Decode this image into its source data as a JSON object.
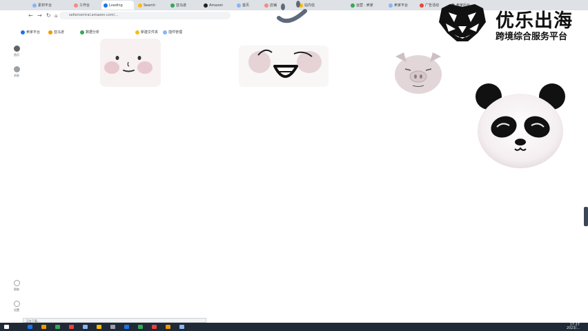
{
  "tabs": [
    {
      "label": "素材平台",
      "color": "#8ab4f8"
    },
    {
      "label": "工作台",
      "color": "#f28b82"
    },
    {
      "label": "Loading",
      "color": "#1a73e8",
      "active": true
    },
    {
      "label": "Search",
      "color": "#fbbc04"
    },
    {
      "label": "亚马逊",
      "color": "#34a853"
    },
    {
      "label": "Amazon",
      "color": "#202124"
    },
    {
      "label": "首页",
      "color": "#8ab4f8"
    },
    {
      "label": "店铺",
      "color": "#f28b82"
    },
    {
      "label": "站内信",
      "color": "#fbbc04"
    },
    {
      "label": "运营 · 卖家",
      "color": "#34a853"
    },
    {
      "label": "卖家平台",
      "color": "#8ab4f8"
    },
    {
      "label": "广告活动",
      "color": "#ea4335"
    },
    {
      "label": "卖家后台",
      "color": "#5f6368"
    }
  ],
  "toolbar": {
    "back": "←",
    "forward": "→",
    "reload": "↻",
    "home": "⌂",
    "url": "sellercentral.amazon.com/..."
  },
  "bookmarks": [
    {
      "label": "卖家平台",
      "color": "#1a73e8"
    },
    {
      "label": "亚马逊",
      "color": "#f29900"
    },
    {
      "label": "数据分析",
      "color": "#34a853"
    },
    {
      "label": "新建文件夹",
      "color": "#fbbc04"
    },
    {
      "label": "插件管理",
      "color": "#8ab4f8"
    }
  ],
  "sidebar": [
    {
      "label": "首页",
      "color": "#5f6368"
    },
    {
      "label": "消息",
      "color": "#9aa0a6"
    }
  ],
  "sidebar_bottom": [
    {
      "label": "帮助",
      "color": "#9aa0a6"
    },
    {
      "label": "设置",
      "color": "#9aa0a6"
    }
  ],
  "brand": {
    "title": "优乐出海",
    "subtitle": "跨境综合服务平台",
    "accent": "#111111"
  },
  "taskbar": {
    "time": "17:27",
    "date": "2023/...",
    "icons": [
      "#1a73e8",
      "#f29900",
      "#34a853",
      "#ea4335",
      "#8ab4f8",
      "#fbbc04",
      "#9aa0a6",
      "#1a73e8",
      "#34a853",
      "#ea4335",
      "#f29900",
      "#8ab4f8"
    ]
  },
  "popup": {
    "label": "正在下载..."
  },
  "stickers": [
    "blush-face-sticker",
    "grin-face-sticker",
    "wink-face-sticker",
    "pig-face-sticker",
    "panda-face-sticker"
  ]
}
